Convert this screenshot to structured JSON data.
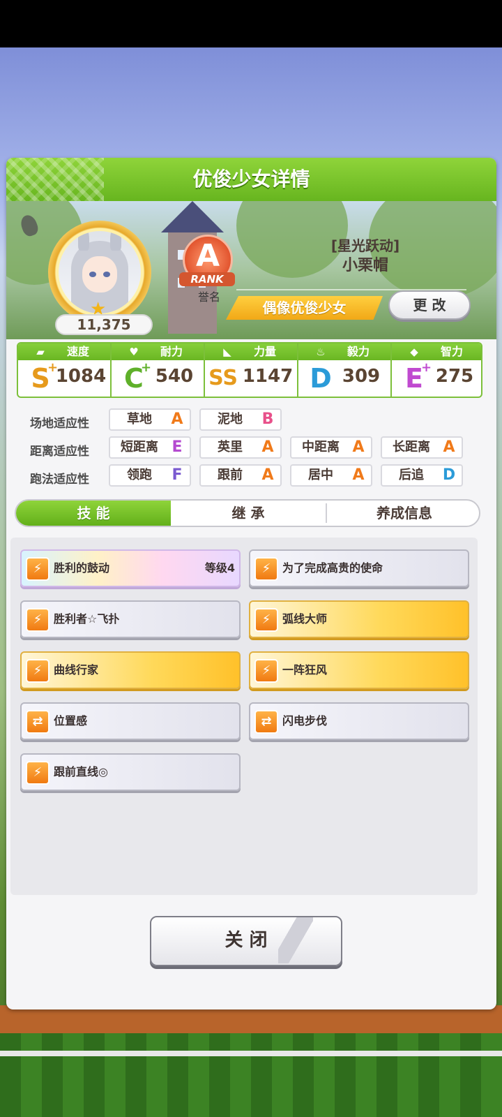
{
  "dialog": {
    "title": "优俊少女详情",
    "close_label": "关 闭"
  },
  "profile": {
    "score": "11,375",
    "rank": {
      "letter": "A",
      "word": "RANK",
      "name": "誉名"
    },
    "char_title": "[星光跃动]",
    "char_name": "小栗帽",
    "type_label": "偶像优俊少女",
    "change_label": "更 改"
  },
  "stats": [
    {
      "label": "速度",
      "icon": "shoe-icon",
      "grade": "S",
      "plus": "+",
      "value": "1084",
      "color": "#e69a1c"
    },
    {
      "label": "耐力",
      "icon": "heart-icon",
      "grade": "C",
      "plus": "+",
      "value": "540",
      "color": "#5fb02a"
    },
    {
      "label": "力量",
      "icon": "muscle-icon",
      "grade": "SS",
      "plus": "",
      "value": "1147",
      "color": "#e69a1c"
    },
    {
      "label": "毅力",
      "icon": "flame-icon",
      "grade": "D",
      "plus": "",
      "value": "309",
      "color": "#2b9bd8"
    },
    {
      "label": "智力",
      "icon": "graduation-cap-icon",
      "grade": "E",
      "plus": "+",
      "value": "275",
      "color": "#c04ad0"
    }
  ],
  "aptitudes": {
    "track": {
      "label": "场地适应性",
      "items": [
        {
          "name": "草地",
          "grade": "A"
        },
        {
          "name": "泥地",
          "grade": "B"
        }
      ]
    },
    "distance": {
      "label": "距离适应性",
      "items": [
        {
          "name": "短距离",
          "grade": "E"
        },
        {
          "name": "英里",
          "grade": "A"
        },
        {
          "name": "中距离",
          "grade": "A"
        },
        {
          "name": "长距离",
          "grade": "A"
        }
      ]
    },
    "style": {
      "label": "跑法适应性",
      "items": [
        {
          "name": "领跑",
          "grade": "F"
        },
        {
          "name": "跟前",
          "grade": "A"
        },
        {
          "name": "居中",
          "grade": "A"
        },
        {
          "name": "后追",
          "grade": "D"
        }
      ]
    }
  },
  "grade_colors": {
    "A": "#f07a1a",
    "B": "#e8508a",
    "D": "#2b9bd8",
    "E": "#b44ad0",
    "F": "#7a5ad0"
  },
  "tabs": [
    {
      "label": "技 能",
      "active": true
    },
    {
      "label": "继 承",
      "active": false
    },
    {
      "label": "养成信息",
      "active": false
    }
  ],
  "skills": [
    {
      "name": "胜利的鼓动",
      "level": "等级4",
      "style": "rainbow",
      "icon": "runner-icon"
    },
    {
      "name": "为了完成高贵的使命",
      "level": "",
      "style": "white",
      "icon": "runner-icon"
    },
    {
      "name": "胜利者☆飞扑",
      "level": "",
      "style": "white",
      "icon": "runner-icon"
    },
    {
      "name": "弧线大师",
      "level": "",
      "style": "gold",
      "icon": "runner-icon"
    },
    {
      "name": "曲线行家",
      "level": "",
      "style": "gold",
      "icon": "runner-icon"
    },
    {
      "name": "一阵狂风",
      "level": "",
      "style": "gold",
      "icon": "runner-icon"
    },
    {
      "name": "位置感",
      "level": "",
      "style": "white",
      "icon": "position-icon"
    },
    {
      "name": "闪电步伐",
      "level": "",
      "style": "white",
      "icon": "position-icon"
    },
    {
      "name": "跟前直线◎",
      "level": "",
      "style": "white",
      "icon": "runner-icon"
    }
  ]
}
